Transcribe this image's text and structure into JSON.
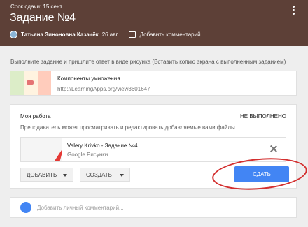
{
  "header": {
    "due": "Срок сдачи: 15 сент.",
    "title": "Задание №4",
    "author": "Татьяна Зиноновна Казачёк",
    "date": "26 авг.",
    "add_comment": "Добавить комментарий"
  },
  "instructions": "Выполните задание и пришлите ответ в виде рисунка (Вставить копию экрана с выполненным заданием)",
  "material": {
    "title": "Компоненты умножения",
    "url": "http://LearningApps.org/view3601647"
  },
  "my_work": {
    "title": "Моя работа",
    "status": "НЕ ВЫПОЛНЕНО",
    "note": "Преподаватель может просматривать и редактировать добавляемые вами файлы",
    "attachment": {
      "title": "Valery Krivko - Задание №4",
      "subtitle": "Google Рисунки"
    },
    "add_button": "ДОБАВИТЬ",
    "create_button": "СОЗДАТЬ",
    "submit_button": "СДАТЬ"
  },
  "private_comment": {
    "placeholder": "Добавить личный комментарий..."
  },
  "colors": {
    "header_bg": "#5d4037",
    "submit": "#4285f4",
    "highlight_ring": "#d32f2f"
  }
}
